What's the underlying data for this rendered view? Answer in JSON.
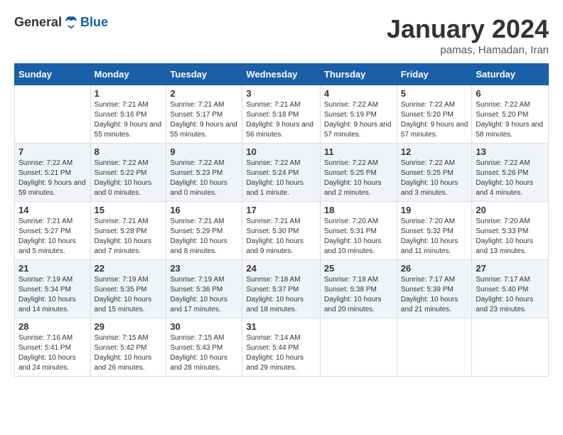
{
  "header": {
    "logo_general": "General",
    "logo_blue": "Blue",
    "month": "January 2024",
    "location": "pamas, Hamadan, Iran"
  },
  "weekdays": [
    "Sunday",
    "Monday",
    "Tuesday",
    "Wednesday",
    "Thursday",
    "Friday",
    "Saturday"
  ],
  "weeks": [
    [
      {
        "day": "",
        "sunrise": "",
        "sunset": "",
        "daylight": ""
      },
      {
        "day": "1",
        "sunrise": "Sunrise: 7:21 AM",
        "sunset": "Sunset: 5:16 PM",
        "daylight": "Daylight: 9 hours and 55 minutes."
      },
      {
        "day": "2",
        "sunrise": "Sunrise: 7:21 AM",
        "sunset": "Sunset: 5:17 PM",
        "daylight": "Daylight: 9 hours and 55 minutes."
      },
      {
        "day": "3",
        "sunrise": "Sunrise: 7:21 AM",
        "sunset": "Sunset: 5:18 PM",
        "daylight": "Daylight: 9 hours and 56 minutes."
      },
      {
        "day": "4",
        "sunrise": "Sunrise: 7:22 AM",
        "sunset": "Sunset: 5:19 PM",
        "daylight": "Daylight: 9 hours and 57 minutes."
      },
      {
        "day": "5",
        "sunrise": "Sunrise: 7:22 AM",
        "sunset": "Sunset: 5:20 PM",
        "daylight": "Daylight: 9 hours and 57 minutes."
      },
      {
        "day": "6",
        "sunrise": "Sunrise: 7:22 AM",
        "sunset": "Sunset: 5:20 PM",
        "daylight": "Daylight: 9 hours and 58 minutes."
      }
    ],
    [
      {
        "day": "7",
        "sunrise": "Sunrise: 7:22 AM",
        "sunset": "Sunset: 5:21 PM",
        "daylight": "Daylight: 9 hours and 59 minutes."
      },
      {
        "day": "8",
        "sunrise": "Sunrise: 7:22 AM",
        "sunset": "Sunset: 5:22 PM",
        "daylight": "Daylight: 10 hours and 0 minutes."
      },
      {
        "day": "9",
        "sunrise": "Sunrise: 7:22 AM",
        "sunset": "Sunset: 5:23 PM",
        "daylight": "Daylight: 10 hours and 0 minutes."
      },
      {
        "day": "10",
        "sunrise": "Sunrise: 7:22 AM",
        "sunset": "Sunset: 5:24 PM",
        "daylight": "Daylight: 10 hours and 1 minute."
      },
      {
        "day": "11",
        "sunrise": "Sunrise: 7:22 AM",
        "sunset": "Sunset: 5:25 PM",
        "daylight": "Daylight: 10 hours and 2 minutes."
      },
      {
        "day": "12",
        "sunrise": "Sunrise: 7:22 AM",
        "sunset": "Sunset: 5:25 PM",
        "daylight": "Daylight: 10 hours and 3 minutes."
      },
      {
        "day": "13",
        "sunrise": "Sunrise: 7:22 AM",
        "sunset": "Sunset: 5:26 PM",
        "daylight": "Daylight: 10 hours and 4 minutes."
      }
    ],
    [
      {
        "day": "14",
        "sunrise": "Sunrise: 7:21 AM",
        "sunset": "Sunset: 5:27 PM",
        "daylight": "Daylight: 10 hours and 5 minutes."
      },
      {
        "day": "15",
        "sunrise": "Sunrise: 7:21 AM",
        "sunset": "Sunset: 5:28 PM",
        "daylight": "Daylight: 10 hours and 7 minutes."
      },
      {
        "day": "16",
        "sunrise": "Sunrise: 7:21 AM",
        "sunset": "Sunset: 5:29 PM",
        "daylight": "Daylight: 10 hours and 8 minutes."
      },
      {
        "day": "17",
        "sunrise": "Sunrise: 7:21 AM",
        "sunset": "Sunset: 5:30 PM",
        "daylight": "Daylight: 10 hours and 9 minutes."
      },
      {
        "day": "18",
        "sunrise": "Sunrise: 7:20 AM",
        "sunset": "Sunset: 5:31 PM",
        "daylight": "Daylight: 10 hours and 10 minutes."
      },
      {
        "day": "19",
        "sunrise": "Sunrise: 7:20 AM",
        "sunset": "Sunset: 5:32 PM",
        "daylight": "Daylight: 10 hours and 11 minutes."
      },
      {
        "day": "20",
        "sunrise": "Sunrise: 7:20 AM",
        "sunset": "Sunset: 5:33 PM",
        "daylight": "Daylight: 10 hours and 13 minutes."
      }
    ],
    [
      {
        "day": "21",
        "sunrise": "Sunrise: 7:19 AM",
        "sunset": "Sunset: 5:34 PM",
        "daylight": "Daylight: 10 hours and 14 minutes."
      },
      {
        "day": "22",
        "sunrise": "Sunrise: 7:19 AM",
        "sunset": "Sunset: 5:35 PM",
        "daylight": "Daylight: 10 hours and 15 minutes."
      },
      {
        "day": "23",
        "sunrise": "Sunrise: 7:19 AM",
        "sunset": "Sunset: 5:36 PM",
        "daylight": "Daylight: 10 hours and 17 minutes."
      },
      {
        "day": "24",
        "sunrise": "Sunrise: 7:18 AM",
        "sunset": "Sunset: 5:37 PM",
        "daylight": "Daylight: 10 hours and 18 minutes."
      },
      {
        "day": "25",
        "sunrise": "Sunrise: 7:18 AM",
        "sunset": "Sunset: 5:38 PM",
        "daylight": "Daylight: 10 hours and 20 minutes."
      },
      {
        "day": "26",
        "sunrise": "Sunrise: 7:17 AM",
        "sunset": "Sunset: 5:39 PM",
        "daylight": "Daylight: 10 hours and 21 minutes."
      },
      {
        "day": "27",
        "sunrise": "Sunrise: 7:17 AM",
        "sunset": "Sunset: 5:40 PM",
        "daylight": "Daylight: 10 hours and 23 minutes."
      }
    ],
    [
      {
        "day": "28",
        "sunrise": "Sunrise: 7:16 AM",
        "sunset": "Sunset: 5:41 PM",
        "daylight": "Daylight: 10 hours and 24 minutes."
      },
      {
        "day": "29",
        "sunrise": "Sunrise: 7:15 AM",
        "sunset": "Sunset: 5:42 PM",
        "daylight": "Daylight: 10 hours and 26 minutes."
      },
      {
        "day": "30",
        "sunrise": "Sunrise: 7:15 AM",
        "sunset": "Sunset: 5:43 PM",
        "daylight": "Daylight: 10 hours and 28 minutes."
      },
      {
        "day": "31",
        "sunrise": "Sunrise: 7:14 AM",
        "sunset": "Sunset: 5:44 PM",
        "daylight": "Daylight: 10 hours and 29 minutes."
      },
      {
        "day": "",
        "sunrise": "",
        "sunset": "",
        "daylight": ""
      },
      {
        "day": "",
        "sunrise": "",
        "sunset": "",
        "daylight": ""
      },
      {
        "day": "",
        "sunrise": "",
        "sunset": "",
        "daylight": ""
      }
    ]
  ]
}
